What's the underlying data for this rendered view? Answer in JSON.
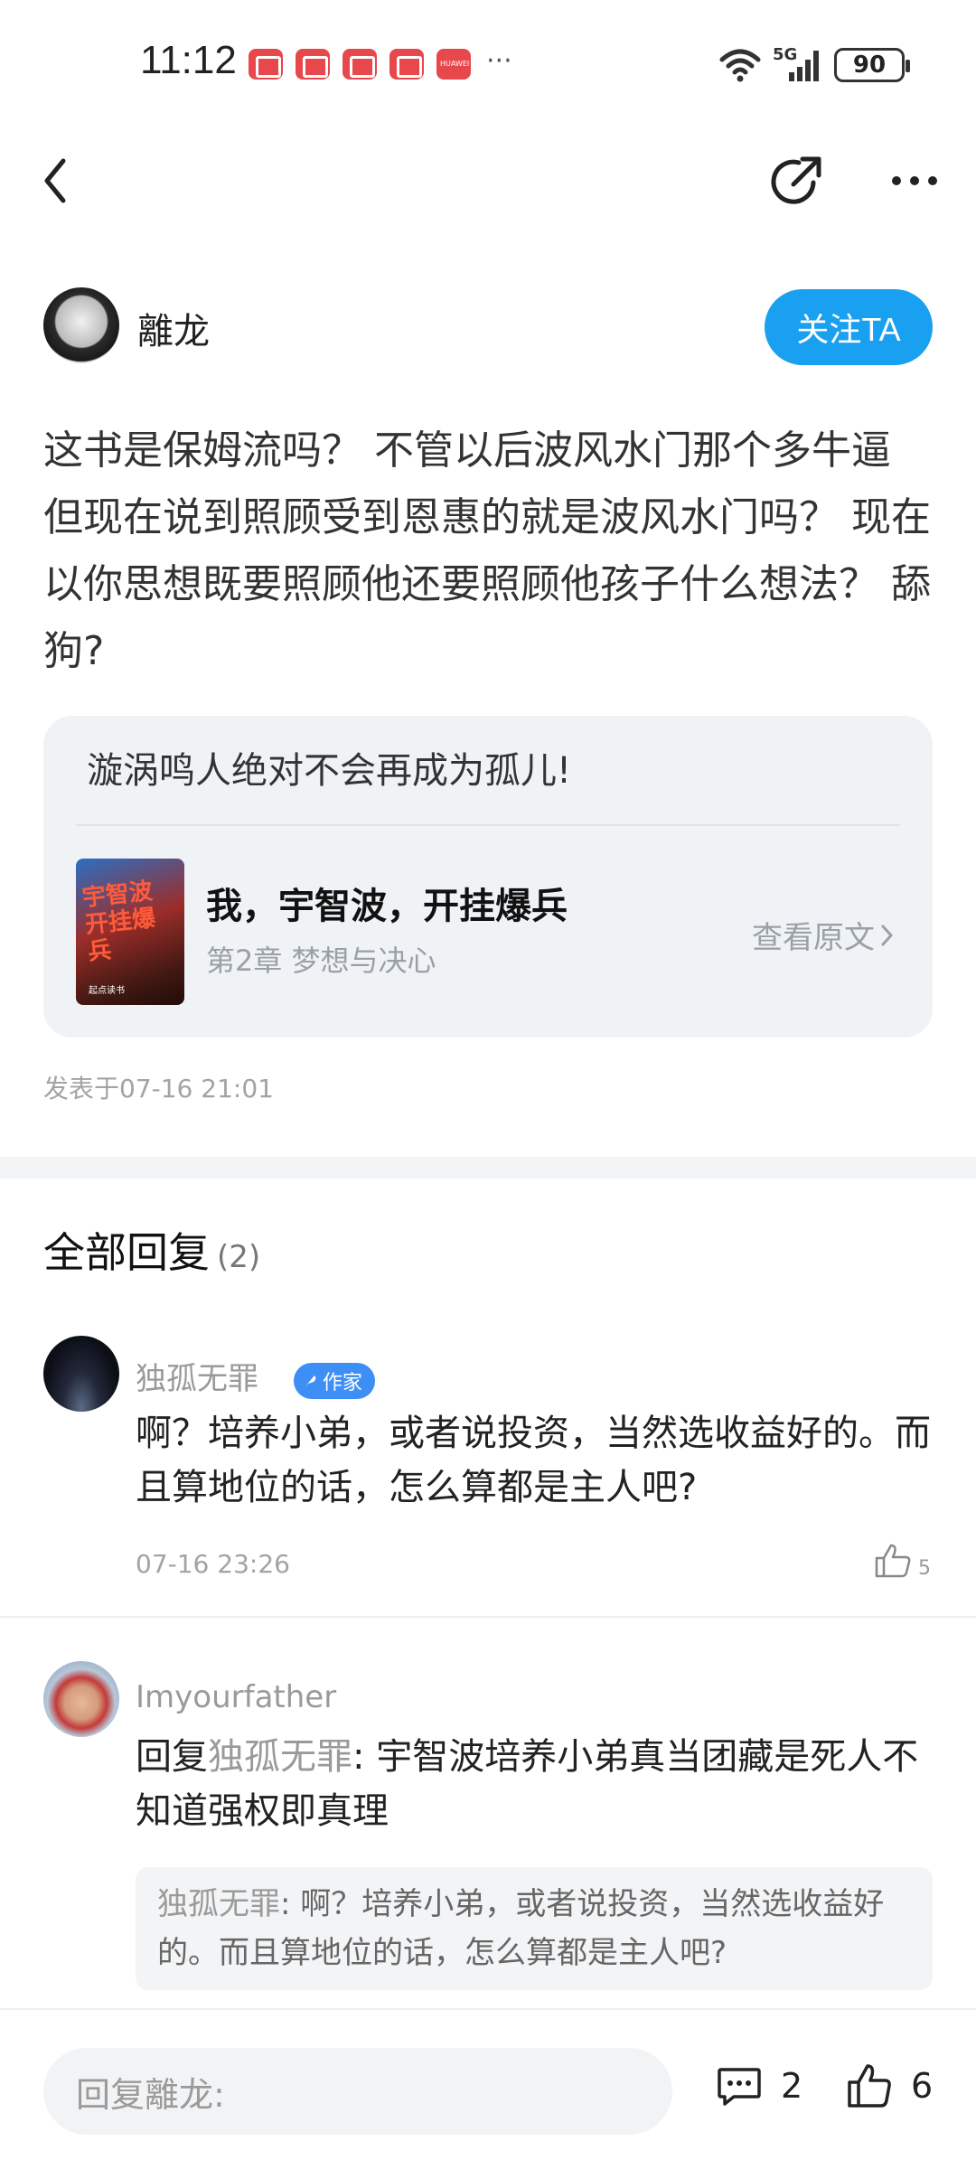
{
  "status_bar": {
    "time": "11:12",
    "more": "···",
    "network": "5G",
    "battery": "90",
    "notification_icons": [
      "reader-app-icon",
      "reader-app-icon",
      "reader-app-icon",
      "reader-app-icon",
      "huawei-store-icon"
    ],
    "huawei_label": "HUAWEI"
  },
  "post": {
    "author_name": "離龙",
    "follow_label": "关注TA",
    "body": "这书是保姆流吗？ 不管以后波风水门那个多牛逼 但现在说到照顾受到恩惠的就是波风水门吗？ 现在以你思想既要照顾他还要照顾他孩子什么想法？ 舔狗?",
    "quote": "漩涡鸣人绝对不会再成为孤儿!",
    "book_title": "我，宇智波，开挂爆兵",
    "book_chapter": "第2章 梦想与决心",
    "view_original": "查看原文",
    "cover_title": "宇智波 开挂爆兵",
    "cover_foot": "起点读书",
    "posted_at": "发表于07-16 21:01"
  },
  "replies_section": {
    "title": "全部回复",
    "count": "(2)"
  },
  "replies": [
    {
      "name": "独孤无罪",
      "badge": "作家",
      "text": "啊？培养小弟，或者说投资，当然选收益好的。而且算地位的话，怎么算都是主人吧?",
      "time": "07-16 23:26",
      "likes": "5"
    },
    {
      "name": "Imyourfather",
      "reply_prefix": "回复",
      "reply_to": "独孤无罪",
      "text": ": 宇智波培养小弟真当团藏是死人不知道强权即真理",
      "quoted_name": "独孤无罪",
      "quoted_text": ": 啊？培养小弟，或者说投资，当然选收益好的。而且算地位的话，怎么算都是主人吧?"
    }
  ],
  "bottom_bar": {
    "input_placeholder": "回复離龙:",
    "comment_count": "2",
    "like_count": "6"
  }
}
